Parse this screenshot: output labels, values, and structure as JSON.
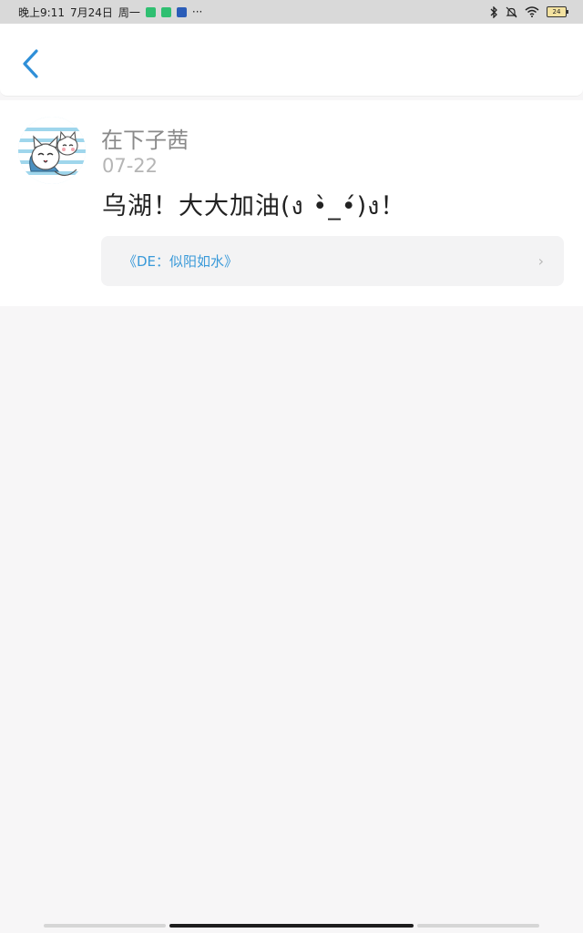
{
  "status_bar": {
    "time": "晚上9:11",
    "date": "7月24日",
    "weekday": "周一",
    "more": "···",
    "battery": "24",
    "app_badge_colors": [
      "#2fbf71",
      "#2fbf71",
      "#2b5db8"
    ],
    "icons": [
      "bluetooth-icon",
      "mute-icon",
      "wifi-icon",
      "battery-icon"
    ]
  },
  "header": {
    "back_icon": "chevron-left-icon",
    "accent_color": "#2f8fd8"
  },
  "comment": {
    "author": "在下子茜",
    "date": "07-22",
    "text": "乌湖！大大加油(ง •̀_•́)ง！",
    "reference": {
      "title": "《DE：似阳如水》",
      "chevron": "›"
    }
  }
}
